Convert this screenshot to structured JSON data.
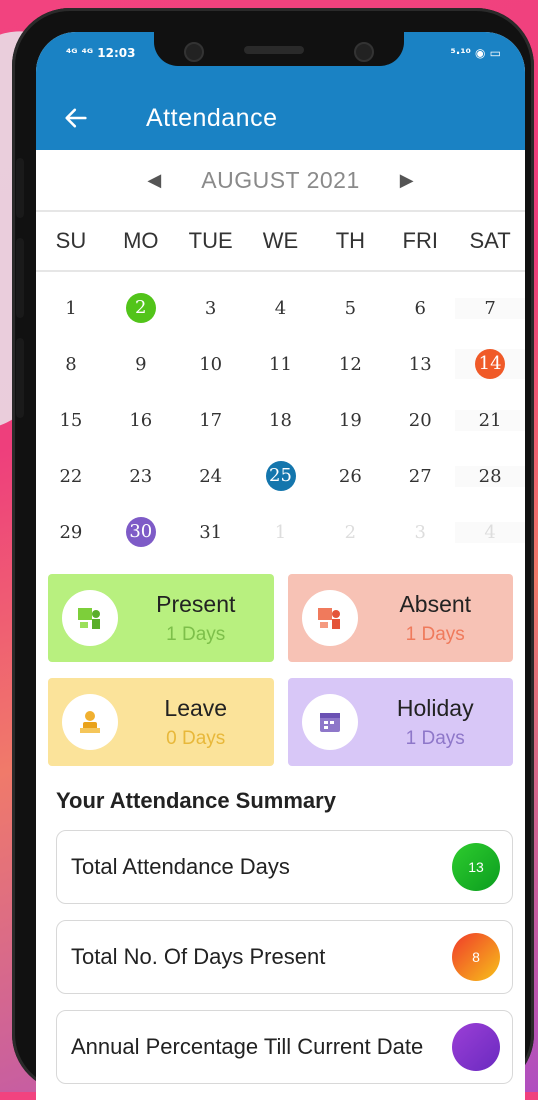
{
  "status_bar": {
    "left": "⁴ᴳ ⁴ᴳ 12:03",
    "right": "⁵·¹⁰ ◉ ▭"
  },
  "app_bar": {
    "title": "Attendance"
  },
  "calendar": {
    "month_label": "AUGUST 2021",
    "weekdays": [
      "SU",
      "MO",
      "TUE",
      "WE",
      "TH",
      "FRI",
      "SAT"
    ],
    "weeks": [
      [
        "1",
        "2",
        "3",
        "4",
        "5",
        "6",
        "7"
      ],
      [
        "8",
        "9",
        "10",
        "11",
        "12",
        "13",
        "14"
      ],
      [
        "15",
        "16",
        "17",
        "18",
        "19",
        "20",
        "21"
      ],
      [
        "22",
        "23",
        "24",
        "25",
        "26",
        "27",
        "28"
      ],
      [
        "29",
        "30",
        "31",
        "1",
        "2",
        "3",
        "4"
      ]
    ],
    "marked": {
      "2": {
        "color": "#52c41a",
        "status": "present"
      },
      "14": {
        "color": "#f05a28",
        "status": "absent"
      },
      "25": {
        "color": "#1476ad",
        "status": "today"
      },
      "30": {
        "color": "#7e5bc7",
        "status": "holiday"
      }
    }
  },
  "cards": [
    {
      "title": "Present",
      "count": "1 Days",
      "bg": "#b8f07f",
      "count_color": "#7dbf4a",
      "icon": "present-icon"
    },
    {
      "title": "Absent",
      "count": "1 Days",
      "bg": "#f7c2b5",
      "count_color": "#ef7a5c",
      "icon": "absent-icon"
    },
    {
      "title": "Leave",
      "count": "0 Days",
      "bg": "#fbe39a",
      "count_color": "#e8b83a",
      "icon": "leave-icon"
    },
    {
      "title": "Holiday",
      "count": "1 Days",
      "bg": "#d8c7f7",
      "count_color": "#8e77c9",
      "icon": "holiday-icon"
    }
  ],
  "summary": {
    "title": "Your Attendance Summary",
    "rows": [
      {
        "label": "Total Attendance Days",
        "value": "13",
        "badge": "linear-gradient(135deg,#2ecc2e,#0b9d1f)"
      },
      {
        "label": "Total No. Of Days Present",
        "value": "8",
        "badge": "linear-gradient(135deg,#f03a2a,#f7c21a)"
      },
      {
        "label": "Annual Percentage Till Current Date",
        "value": "",
        "badge": "linear-gradient(135deg,#9b3fd6,#6a2ac0)"
      }
    ]
  }
}
